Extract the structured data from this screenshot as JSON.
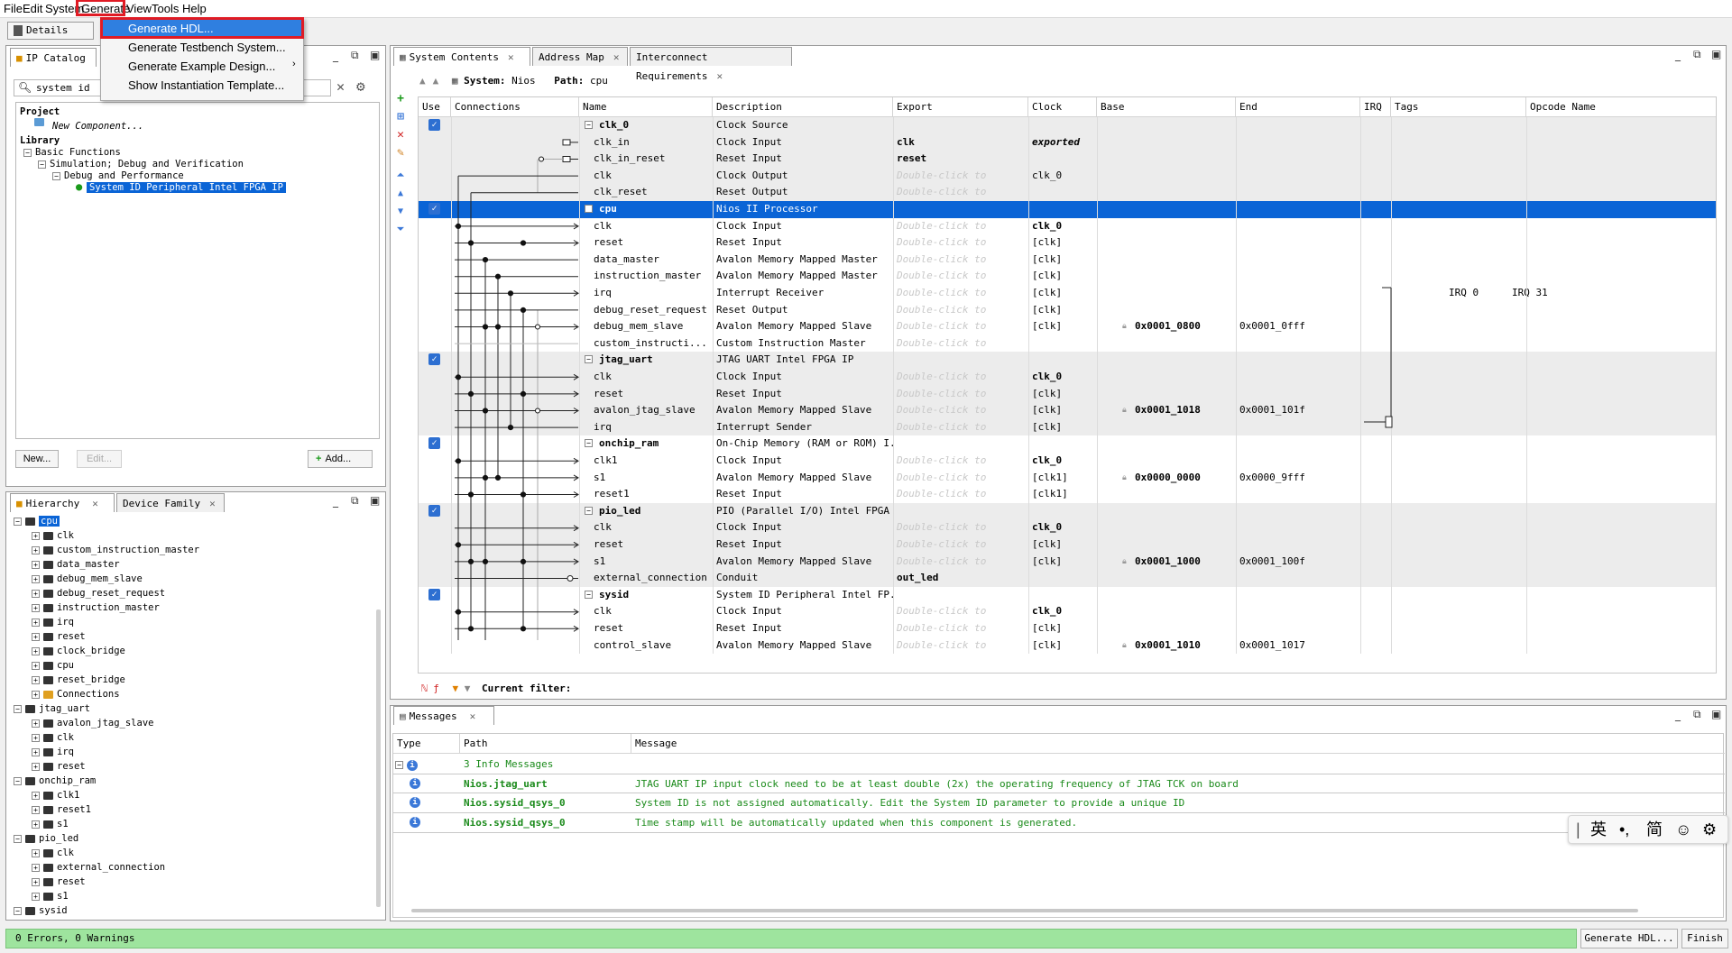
{
  "menu": {
    "items": [
      "File",
      "Edit",
      "System",
      "Generate",
      "View",
      "Tools",
      "Help"
    ]
  },
  "generate_menu": {
    "items": [
      "Generate HDL...",
      "Generate Testbench System...",
      "Generate Example Design...",
      "Show Instantiation Template..."
    ]
  },
  "details_tab": "Details",
  "ip_catalog": {
    "tab": "IP Catalog",
    "search_value": "system id",
    "tree": [
      {
        "label": "Project",
        "level": 0,
        "bold": true
      },
      {
        "label": "New Component...",
        "level": 1,
        "italic": true
      },
      {
        "label": "Library",
        "level": 0,
        "bold": true
      },
      {
        "label": "Basic Functions",
        "level": 1
      },
      {
        "label": "Simulation; Debug and Verification",
        "level": 2
      },
      {
        "label": "Debug and Performance",
        "level": 3
      },
      {
        "label": "System ID Peripheral Intel FPGA IP",
        "level": 4,
        "selected": true
      }
    ],
    "new_button": "New...",
    "edit_button": "Edit...",
    "add_button": "Add..."
  },
  "hierarchy": {
    "tabs": [
      "Hierarchy",
      "Device Family"
    ],
    "items": [
      {
        "label": "cpu",
        "level": 0,
        "selected": true
      },
      {
        "label": "clk",
        "level": 1
      },
      {
        "label": "custom_instruction_master",
        "level": 1
      },
      {
        "label": "data_master",
        "level": 1
      },
      {
        "label": "debug_mem_slave",
        "level": 1
      },
      {
        "label": "debug_reset_request",
        "level": 1
      },
      {
        "label": "instruction_master",
        "level": 1
      },
      {
        "label": "irq",
        "level": 1
      },
      {
        "label": "reset",
        "level": 1
      },
      {
        "label": "clock_bridge",
        "level": 1
      },
      {
        "label": "cpu",
        "level": 1
      },
      {
        "label": "reset_bridge",
        "level": 1
      },
      {
        "label": "Connections",
        "level": 1
      },
      {
        "label": "jtag_uart",
        "level": 0
      },
      {
        "label": "avalon_jtag_slave",
        "level": 1
      },
      {
        "label": "clk",
        "level": 1
      },
      {
        "label": "irq",
        "level": 1
      },
      {
        "label": "reset",
        "level": 1
      },
      {
        "label": "onchip_ram",
        "level": 0
      },
      {
        "label": "clk1",
        "level": 1
      },
      {
        "label": "reset1",
        "level": 1
      },
      {
        "label": "s1",
        "level": 1
      },
      {
        "label": "pio_led",
        "level": 0
      },
      {
        "label": "clk",
        "level": 1
      },
      {
        "label": "external_connection",
        "level": 1
      },
      {
        "label": "reset",
        "level": 1
      },
      {
        "label": "s1",
        "level": 1
      },
      {
        "label": "sysid",
        "level": 0
      }
    ]
  },
  "system_contents": {
    "tabs": [
      "System Contents",
      "Address Map",
      "Interconnect Requirements"
    ],
    "system_label": "System:",
    "system_name": "Nios",
    "path_label": "Path:",
    "path_value": "cpu",
    "columns": [
      "Use",
      "Connections",
      "Name",
      "Description",
      "Export",
      "Clock",
      "Base",
      "End",
      "IRQ",
      "Tags",
      "Opcode Name"
    ],
    "rows": [
      {
        "use": true,
        "name": "clk_0",
        "bold": true,
        "desc": "Clock Source",
        "export": "",
        "clock": "",
        "base": "",
        "end": ""
      },
      {
        "name": "clk_in",
        "desc": "Clock Input",
        "export": "clk",
        "clock": "exported"
      },
      {
        "name": "clk_in_reset",
        "desc": "Reset Input",
        "export": "reset",
        "clock": ""
      },
      {
        "name": "clk",
        "desc": "Clock Output",
        "export": "Double-click to",
        "clock": "clk_0"
      },
      {
        "name": "clk_reset",
        "desc": "Reset Output",
        "export": "Double-click to",
        "clock": ""
      },
      {
        "use": true,
        "name": "cpu",
        "bold": true,
        "desc": "Nios II Processor",
        "selected": true
      },
      {
        "name": "clk",
        "desc": "Clock Input",
        "export": "Double-click to",
        "clock": "clk_0"
      },
      {
        "name": "reset",
        "desc": "Reset Input",
        "export": "Double-click to",
        "clock": "[clk]"
      },
      {
        "name": "data_master",
        "desc": "Avalon Memory Mapped Master",
        "export": "Double-click to",
        "clock": "[clk]"
      },
      {
        "name": "instruction_master",
        "desc": "Avalon Memory Mapped Master",
        "export": "Double-click to",
        "clock": "[clk]"
      },
      {
        "name": "irq",
        "desc": "Interrupt Receiver",
        "export": "Double-click to",
        "clock": "[clk]",
        "irq": "IRQ 0",
        "irq2": "IRQ 31"
      },
      {
        "name": "debug_reset_request",
        "desc": "Reset Output",
        "export": "Double-click to",
        "clock": "[clk]"
      },
      {
        "name": "debug_mem_slave",
        "desc": "Avalon Memory Mapped Slave",
        "export": "Double-click to",
        "clock": "[clk]",
        "base": "0x0001_0800",
        "end": "0x0001_0fff"
      },
      {
        "name": "custom_instructi...",
        "desc": "Custom Instruction Master",
        "export": "Double-click to",
        "clock": ""
      },
      {
        "use": true,
        "name": "jtag_uart",
        "bold": true,
        "desc": "JTAG UART Intel FPGA IP"
      },
      {
        "name": "clk",
        "desc": "Clock Input",
        "export": "Double-click to",
        "clock": "clk_0"
      },
      {
        "name": "reset",
        "desc": "Reset Input",
        "export": "Double-click to",
        "clock": "[clk]"
      },
      {
        "name": "avalon_jtag_slave",
        "desc": "Avalon Memory Mapped Slave",
        "export": "Double-click to",
        "clock": "[clk]",
        "base": "0x0001_1018",
        "end": "0x0001_101f"
      },
      {
        "name": "irq",
        "desc": "Interrupt Sender",
        "export": "Double-click to",
        "clock": "[clk]"
      },
      {
        "use": true,
        "name": "onchip_ram",
        "bold": true,
        "desc": "On-Chip Memory (RAM or ROM) I..."
      },
      {
        "name": "clk1",
        "desc": "Clock Input",
        "export": "Double-click to",
        "clock": "clk_0"
      },
      {
        "name": "s1",
        "desc": "Avalon Memory Mapped Slave",
        "export": "Double-click to",
        "clock": "[clk1]",
        "base": "0x0000_0000",
        "end": "0x0000_9fff"
      },
      {
        "name": "reset1",
        "desc": "Reset Input",
        "export": "Double-click to",
        "clock": "[clk1]"
      },
      {
        "use": true,
        "name": "pio_led",
        "bold": true,
        "desc": "PIO (Parallel I/O) Intel FPGA IP"
      },
      {
        "name": "clk",
        "desc": "Clock Input",
        "export": "Double-click to",
        "clock": "clk_0"
      },
      {
        "name": "reset",
        "desc": "Reset Input",
        "export": "Double-click to",
        "clock": "[clk]"
      },
      {
        "name": "s1",
        "desc": "Avalon Memory Mapped Slave",
        "export": "Double-click to",
        "clock": "[clk]",
        "base": "0x0001_1000",
        "end": "0x0001_100f"
      },
      {
        "name": "external_connection",
        "desc": "Conduit",
        "export": "out_led",
        "clock": ""
      },
      {
        "use": true,
        "name": "sysid",
        "bold": true,
        "desc": "System ID Peripheral Intel FP..."
      },
      {
        "name": "clk",
        "desc": "Clock Input",
        "export": "Double-click to",
        "clock": "clk_0"
      },
      {
        "name": "reset",
        "desc": "Reset Input",
        "export": "Double-click to",
        "clock": "[clk]"
      },
      {
        "name": "control_slave",
        "desc": "Avalon Memory Mapped Slave",
        "export": "Double-click to",
        "clock": "[clk]",
        "base": "0x0001_1010",
        "end": "0x0001_1017"
      }
    ],
    "filter_label": "Current filter:"
  },
  "messages": {
    "tab": "Messages",
    "columns": [
      "Type",
      "Path",
      "Message"
    ],
    "summary": "3 Info Messages",
    "items": [
      {
        "path": "Nios.jtag_uart",
        "message": "JTAG UART IP input clock need to be at least double (2x) the operating frequency of JTAG TCK on board"
      },
      {
        "path": "Nios.sysid_qsys_0",
        "message": "System ID is not assigned automatically. Edit the System ID parameter to provide a unique ID"
      },
      {
        "path": "Nios.sysid_qsys_0",
        "message": "Time stamp will be automatically updated when this component is generated."
      }
    ]
  },
  "ime": {
    "items": [
      "英",
      "•,",
      "简"
    ]
  },
  "status": {
    "text": "0 Errors, 0 Warnings",
    "generate_button": "Generate HDL...",
    "finish_button": "Finish"
  },
  "colors": {
    "accent": "#2f7fe0",
    "selected_row": "#0a64d6",
    "status_bg": "#9ee49e",
    "highlight": "#e01b24"
  }
}
